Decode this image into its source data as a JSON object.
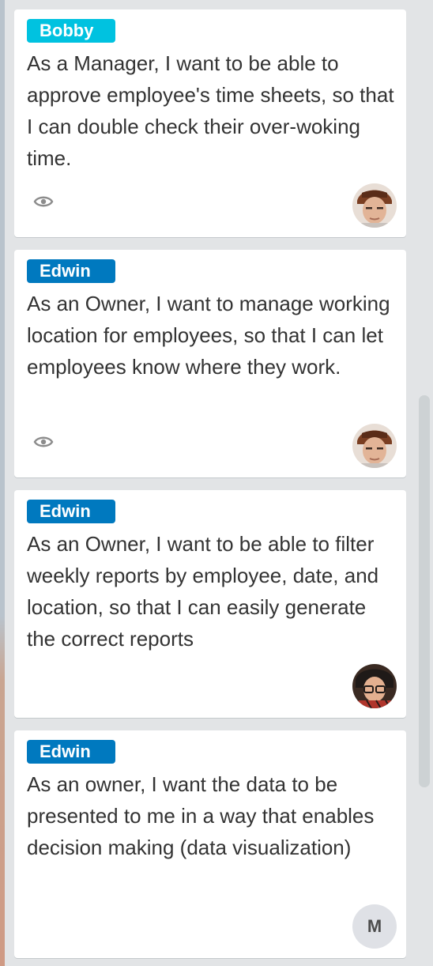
{
  "cards": [
    {
      "label": "Bobby",
      "label_color": "#00c2e0",
      "title": "As a Manager, I want to be able to approve employee's time sheets, so that I can double check their over-woking time.",
      "has_watch_icon": true,
      "avatar": "photo-man-cap"
    },
    {
      "label": "Edwin",
      "label_color": "#0079bf",
      "title": "As an Owner, I want to manage working location for employees, so that I can let employees know where they work.",
      "has_watch_icon": true,
      "avatar": "photo-man-cap"
    },
    {
      "label": "Edwin",
      "label_color": "#0079bf",
      "title": "As an Owner, I want to be able to filter weekly reports by employee, date, and location, so that I can easily generate the correct reports",
      "has_watch_icon": false,
      "avatar": "photo-man-glasses"
    },
    {
      "label": "Edwin",
      "label_color": "#0079bf",
      "title": "As an owner, I want the data to be presented to me in a way that enables decision making (data visualization)",
      "has_watch_icon": false,
      "avatar": "initial",
      "avatar_initial": "M"
    }
  ],
  "icons": {
    "watch": "eye-icon"
  }
}
